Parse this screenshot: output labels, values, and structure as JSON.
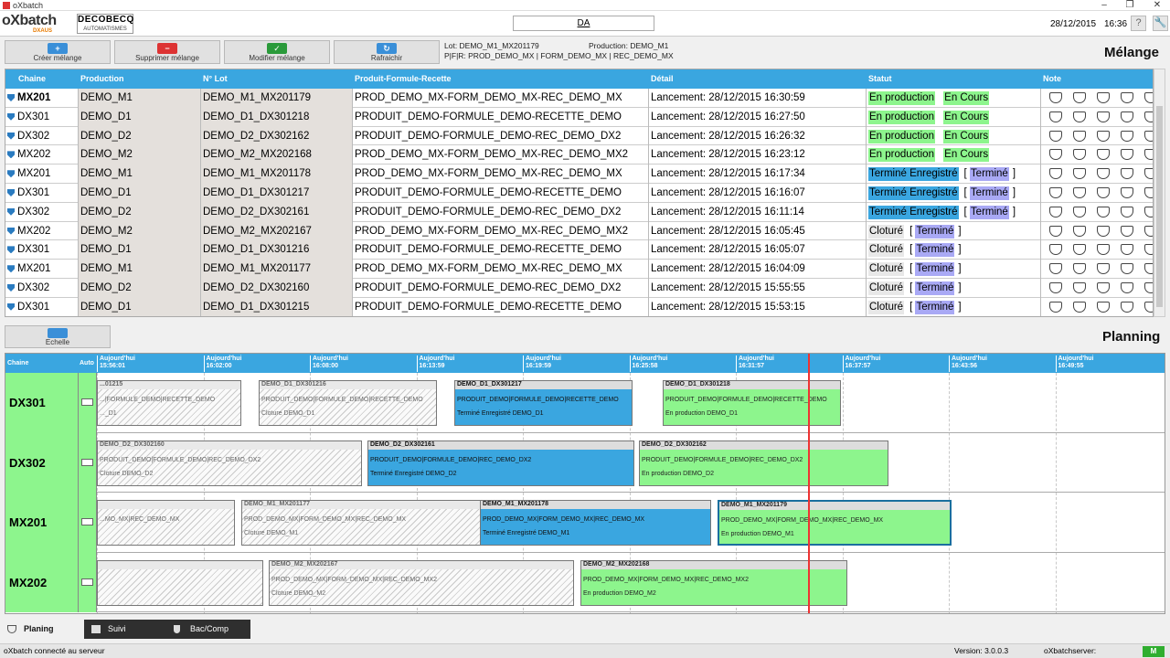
{
  "window": {
    "title": "oXbatch"
  },
  "header": {
    "logo": "oXbatch",
    "logo_sub": "DXAUS",
    "partner_logo_line1": "DECOBECQ",
    "partner_logo_line2": "AUTOMATISMES",
    "user": "DA",
    "date": "28/12/2015",
    "time": "16:36",
    "help_icon": "question-icon",
    "settings_icon": "wrench-icon"
  },
  "toolbar": {
    "create_label": "Créer mélange",
    "delete_label": "Supprimer mélange",
    "edit_label": "Modifier mélange",
    "refresh_label": "Rafraichir"
  },
  "lot_info": {
    "lot": "Lot: DEMO_M1_MX201179",
    "production": "Production: DEMO_M1",
    "pfr": "P|F|R: PROD_DEMO_MX | FORM_DEMO_MX | REC_DEMO_MX"
  },
  "melange": {
    "title": "Mélange",
    "columns": {
      "chaine": "Chaine",
      "production": "Production",
      "lot": "N° Lot",
      "pfr": "Produit-Formule-Recette",
      "detail": "Détail",
      "statut": "Statut",
      "note": "Note"
    },
    "rows": [
      {
        "chaine": "MX201",
        "production": "DEMO_M1",
        "lot": "DEMO_M1_MX201179",
        "pfr": "PROD_DEMO_MX-FORM_DEMO_MX-REC_DEMO_MX",
        "detail": "Lancement: 28/12/2015 16:30:59",
        "status1": "En production",
        "status2": "En Cours",
        "open": "",
        "close": ""
      },
      {
        "chaine": "DX301",
        "production": "DEMO_D1",
        "lot": "DEMO_D1_DX301218",
        "pfr": "PRODUIT_DEMO-FORMULE_DEMO-RECETTE_DEMO",
        "detail": "Lancement: 28/12/2015 16:27:50",
        "status1": "En production",
        "status2": "En Cours",
        "open": "",
        "close": ""
      },
      {
        "chaine": "DX302",
        "production": "DEMO_D2",
        "lot": "DEMO_D2_DX302162",
        "pfr": "PRODUIT_DEMO-FORMULE_DEMO-REC_DEMO_DX2",
        "detail": "Lancement: 28/12/2015 16:26:32",
        "status1": "En production",
        "status2": "En Cours",
        "open": "",
        "close": ""
      },
      {
        "chaine": "MX202",
        "production": "DEMO_M2",
        "lot": "DEMO_M2_MX202168",
        "pfr": "PROD_DEMO_MX-FORM_DEMO_MX-REC_DEMO_MX2",
        "detail": "Lancement: 28/12/2015 16:23:12",
        "status1": "En production",
        "status2": "En Cours",
        "open": "",
        "close": ""
      },
      {
        "chaine": "MX201",
        "production": "DEMO_M1",
        "lot": "DEMO_M1_MX201178",
        "pfr": "PROD_DEMO_MX-FORM_DEMO_MX-REC_DEMO_MX",
        "detail": "Lancement: 28/12/2015 16:17:34",
        "status1": "Terminé Enregistré",
        "status2": "Terminé",
        "open": "[",
        "close": "]"
      },
      {
        "chaine": "DX301",
        "production": "DEMO_D1",
        "lot": "DEMO_D1_DX301217",
        "pfr": "PRODUIT_DEMO-FORMULE_DEMO-RECETTE_DEMO",
        "detail": "Lancement: 28/12/2015 16:16:07",
        "status1": "Terminé Enregistré",
        "status2": "Terminé",
        "open": "[",
        "close": "]"
      },
      {
        "chaine": "DX302",
        "production": "DEMO_D2",
        "lot": "DEMO_D2_DX302161",
        "pfr": "PRODUIT_DEMO-FORMULE_DEMO-REC_DEMO_DX2",
        "detail": "Lancement: 28/12/2015 16:11:14",
        "status1": "Terminé Enregistré",
        "status2": "Terminé",
        "open": "[",
        "close": "]"
      },
      {
        "chaine": "MX202",
        "production": "DEMO_M2",
        "lot": "DEMO_M2_MX202167",
        "pfr": "PROD_DEMO_MX-FORM_DEMO_MX-REC_DEMO_MX2",
        "detail": "Lancement: 28/12/2015 16:05:45",
        "status1": "Cloturé",
        "status2": "Terminé",
        "open": "[",
        "close": "]"
      },
      {
        "chaine": "DX301",
        "production": "DEMO_D1",
        "lot": "DEMO_D1_DX301216",
        "pfr": "PRODUIT_DEMO-FORMULE_DEMO-RECETTE_DEMO",
        "detail": "Lancement: 28/12/2015 16:05:07",
        "status1": "Cloturé",
        "status2": "Terminé",
        "open": "[",
        "close": "]"
      },
      {
        "chaine": "MX201",
        "production": "DEMO_M1",
        "lot": "DEMO_M1_MX201177",
        "pfr": "PROD_DEMO_MX-FORM_DEMO_MX-REC_DEMO_MX",
        "detail": "Lancement: 28/12/2015 16:04:09",
        "status1": "Cloturé",
        "status2": "Terminé",
        "open": "[",
        "close": "]"
      },
      {
        "chaine": "DX302",
        "production": "DEMO_D2",
        "lot": "DEMO_D2_DX302160",
        "pfr": "PRODUIT_DEMO-FORMULE_DEMO-REC_DEMO_DX2",
        "detail": "Lancement: 28/12/2015 15:55:55",
        "status1": "Cloturé",
        "status2": "Terminé",
        "open": "[",
        "close": "]"
      },
      {
        "chaine": "DX301",
        "production": "DEMO_D1",
        "lot": "DEMO_D1_DX301215",
        "pfr": "PRODUIT_DEMO-FORMULE_DEMO-RECETTE_DEMO",
        "detail": "Lancement: 28/12/2015 15:53:15",
        "status1": "Cloturé",
        "status2": "Terminé",
        "open": "[",
        "close": "]"
      }
    ]
  },
  "echelle_label": "Echelle",
  "planning": {
    "title": "Planning",
    "col_chaine": "Chaine",
    "col_auto": "Auto",
    "ticks": [
      {
        "day": "Aujourd'hui",
        "time": "15:56:01"
      },
      {
        "day": "Aujourd'hui",
        "time": "16:02:00"
      },
      {
        "day": "Aujourd'hui",
        "time": "16:08:00"
      },
      {
        "day": "Aujourd'hui",
        "time": "16:13:59"
      },
      {
        "day": "Aujourd'hui",
        "time": "16:19:59"
      },
      {
        "day": "Aujourd'hui",
        "time": "16:25:58"
      },
      {
        "day": "Aujourd'hui",
        "time": "16:31:57"
      },
      {
        "day": "Aujourd'hui",
        "time": "16:37:57"
      },
      {
        "day": "Aujourd'hui",
        "time": "16:43:56"
      },
      {
        "day": "Aujourd'hui",
        "time": "16:49:55"
      }
    ],
    "lanes": [
      {
        "name": "DX301",
        "blocks": [
          {
            "title": "...01215",
            "pfr": "...|FORMULE_DEMO|RECETTE_DEMO",
            "status": "..._D1",
            "kind": "clot"
          },
          {
            "title": "DEMO_D1_DX301216",
            "pfr": "PRODUIT_DEMO|FORMULE_DEMO|RECETTE_DEMO",
            "status": "Cloture   DEMO_D1",
            "kind": "clot"
          },
          {
            "title": "DEMO_D1_DX301217",
            "pfr": "PRODUIT_DEMO|FORMULE_DEMO|RECETTE_DEMO",
            "status": "Terminé Enregistré   DEMO_D1",
            "kind": "enr"
          },
          {
            "title": "DEMO_D1_DX301218",
            "pfr": "PRODUIT_DEMO|FORMULE_DEMO|RECETTE_DEMO",
            "status": "En production   DEMO_D1",
            "kind": "prod"
          }
        ]
      },
      {
        "name": "DX302",
        "blocks": [
          {
            "title": "DEMO_D2_DX302160",
            "pfr": "PRODUIT_DEMO|FORMULE_DEMO|REC_DEMO_DX2",
            "status": "Cloture   DEMO_D2",
            "kind": "clot"
          },
          {
            "title": "DEMO_D2_DX302161",
            "pfr": "PRODUIT_DEMO|FORMULE_DEMO|REC_DEMO_DX2",
            "status": "Terminé Enregistré   DEMO_D2",
            "kind": "enr"
          },
          {
            "title": "DEMO_D2_DX302162",
            "pfr": "PRODUIT_DEMO|FORMULE_DEMO|REC_DEMO_DX2",
            "status": "En production   DEMO_D2",
            "kind": "prod"
          }
        ]
      },
      {
        "name": "MX201",
        "blocks": [
          {
            "title": "",
            "pfr": "...MO_MX|REC_DEMO_MX",
            "status": "",
            "kind": "clot"
          },
          {
            "title": "DEMO_M1_MX201177",
            "pfr": "PROD_DEMO_MX|FORM_DEMO_MX|REC_DEMO_MX",
            "status": "Cloture   DEMO_M1",
            "kind": "clot"
          },
          {
            "title": "DEMO_M1_MX201178",
            "pfr": "PROD_DEMO_MX|FORM_DEMO_MX|REC_DEMO_MX",
            "status": "Terminé Enregistré   DEMO_M1",
            "kind": "enr"
          },
          {
            "title": "DEMO_M1_MX201179",
            "pfr": "PROD_DEMO_MX|FORM_DEMO_MX|REC_DEMO_MX",
            "status": "En production   DEMO_M1",
            "kind": "prod cur"
          }
        ]
      },
      {
        "name": "MX202",
        "blocks": [
          {
            "title": "",
            "pfr": "",
            "status": "",
            "kind": "clot"
          },
          {
            "title": "DEMO_M2_MX202167",
            "pfr": "PROD_DEMO_MX|FORM_DEMO_MX|REC_DEMO_MX2",
            "status": "Cloture   DEMO_M2",
            "kind": "clot"
          },
          {
            "title": "DEMO_M2_MX202168",
            "pfr": "PROD_DEMO_MX|FORM_DEMO_MX|REC_DEMO_MX2",
            "status": "En production   DEMO_M2",
            "kind": "prod"
          }
        ]
      }
    ]
  },
  "tabs": {
    "planing": "Planing",
    "suivi": "Suivi",
    "bac": "Bac/Comp"
  },
  "status_bar": {
    "message": "oXbatch connecté au serveur",
    "version": "Version: 3.0.0.3",
    "server": "oXbatchserver:",
    "ok": "M"
  },
  "colors": {
    "accent": "#3aa6e0",
    "production": "#8df58d",
    "termine": "#a9a9f5",
    "now_line": "#e33333"
  }
}
